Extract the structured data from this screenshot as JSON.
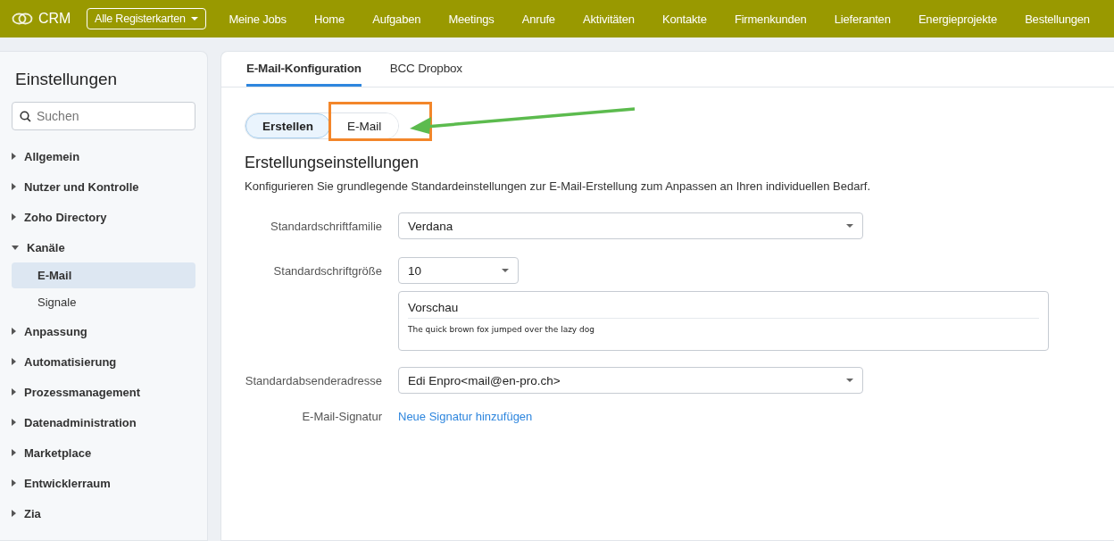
{
  "topbar": {
    "logo": "CRM",
    "all_tabs": "Alle Registerkarten",
    "nav": [
      "Meine Jobs",
      "Home",
      "Aufgaben",
      "Meetings",
      "Anrufe",
      "Aktivitäten",
      "Kontakte",
      "Firmenkunden",
      "Lieferanten",
      "Energieprojekte",
      "Bestellungen"
    ]
  },
  "sidebar": {
    "title": "Einstellungen",
    "search": {
      "placeholder": "Suchen"
    },
    "items": [
      {
        "label": "Allgemein",
        "expanded": false
      },
      {
        "label": "Nutzer und Kontrolle",
        "expanded": false
      },
      {
        "label": "Zoho Directory",
        "expanded": false
      },
      {
        "label": "Kanäle",
        "expanded": true,
        "children": [
          {
            "label": "E-Mail",
            "selected": true
          },
          {
            "label": "Signale",
            "selected": false
          }
        ]
      },
      {
        "label": "Anpassung",
        "expanded": false
      },
      {
        "label": "Automatisierung",
        "expanded": false
      },
      {
        "label": "Prozessmanagement",
        "expanded": false
      },
      {
        "label": "Datenadministration",
        "expanded": false
      },
      {
        "label": "Marketplace",
        "expanded": false
      },
      {
        "label": "Entwicklerraum",
        "expanded": false
      },
      {
        "label": "Zia",
        "expanded": false
      }
    ]
  },
  "tabs": [
    {
      "label": "E-Mail-Konfiguration",
      "selected": true
    },
    {
      "label": "BCC Dropbox",
      "selected": false
    }
  ],
  "segments": [
    {
      "label": "Erstellen",
      "selected": true
    },
    {
      "label": "E-Mail",
      "selected": false
    }
  ],
  "heading": "Erstellungseinstellungen",
  "description": "Konfigurieren Sie grundlegende Standardeinstellungen zur E-Mail-Erstellung zum Anpassen an Ihren individuellen Bedarf.",
  "form": [
    {
      "kind": "select",
      "label": "Standardschriftfamilie",
      "value": "Verdana"
    },
    {
      "kind": "size_select",
      "label": "Standardschriftgröße",
      "value": "10"
    },
    {
      "kind": "preview",
      "title": "Vorschau",
      "sample": "The quick brown fox jumped over the lazy dog"
    },
    {
      "kind": "select",
      "label": "Standardabsenderadresse",
      "value": "Edi Enpro<mail@en-pro.ch>"
    },
    {
      "kind": "link",
      "label": "E-Mail-Signatur",
      "value": "Neue Signatur hinzufügen"
    }
  ]
}
